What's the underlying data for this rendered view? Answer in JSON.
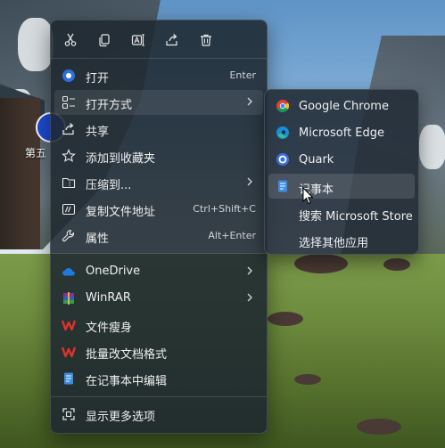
{
  "desktop": {
    "shortcut_label": "第五"
  },
  "toolbar": {
    "cut_icon": "scissors-icon",
    "copy_icon": "copy-icon",
    "rename_icon": "rename-icon",
    "share_icon": "share-icon",
    "delete_icon": "trash-icon"
  },
  "menu": {
    "open": {
      "label": "打开",
      "shortcut": "Enter"
    },
    "open_with": {
      "label": "打开方式"
    },
    "share": {
      "label": "共享"
    },
    "favorites": {
      "label": "添加到收藏夹"
    },
    "compress": {
      "label": "压缩到..."
    },
    "copy_path": {
      "label": "复制文件地址",
      "shortcut": "Ctrl+Shift+C"
    },
    "properties": {
      "label": "属性",
      "shortcut": "Alt+Enter"
    },
    "onedrive": {
      "label": "OneDrive"
    },
    "winrar": {
      "label": "WinRAR"
    },
    "file_slim": {
      "label": "文件瘦身"
    },
    "batch_format": {
      "label": "批量改文档格式"
    },
    "edit_notepad": {
      "label": "在记事本中编辑"
    },
    "more_options": {
      "label": "显示更多选项"
    }
  },
  "submenu": {
    "items": [
      {
        "label": "Google Chrome"
      },
      {
        "label": "Microsoft Edge"
      },
      {
        "label": "Quark"
      },
      {
        "label": "记事本"
      },
      {
        "label": "搜索 Microsoft Store"
      },
      {
        "label": "选择其他应用"
      }
    ]
  },
  "colors": {
    "menu_bg": "#1e2830",
    "hover": "#ffffff17",
    "wps_red": "#e0322b",
    "accent_blue": "#4aa3ff"
  }
}
